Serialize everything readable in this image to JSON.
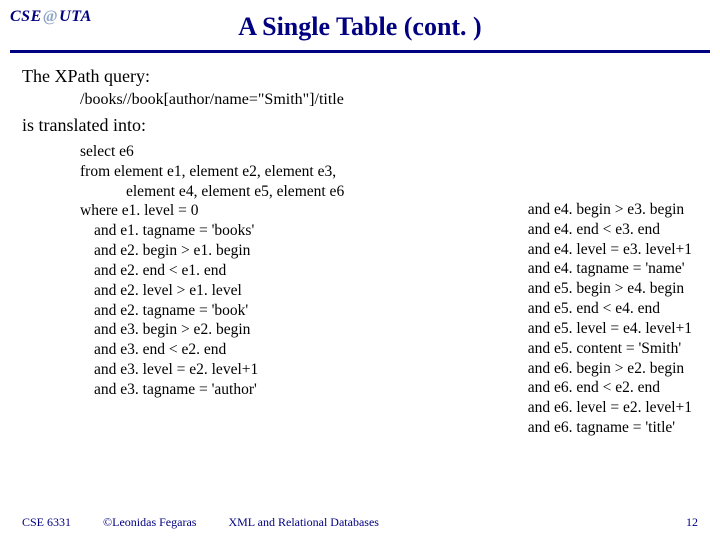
{
  "logo": {
    "prefix": "CSE",
    "at": "@",
    "suffix": "UTA"
  },
  "title": "A Single Table (cont. )",
  "body": {
    "intro1": "The XPath query:",
    "xpath": "/books//book[author/name=\"Smith\"]/title",
    "intro2": "is translated into:",
    "sql_left": [
      "select e6",
      "from element e1, element e2, element e3,",
      "        element e4, element e5, element e6",
      "where e1. level = 0",
      "  and e1. tagname = 'books'",
      "  and e2. begin > e1. begin",
      "  and e2. end < e1. end",
      "  and e2. level > e1. level",
      "  and e2. tagname = 'book'",
      "  and e3. begin > e2. begin",
      "  and e3. end < e2. end",
      "  and e3. level = e2. level+1",
      "  and e3. tagname = 'author'"
    ],
    "sql_right": [
      " and e4. begin > e3. begin",
      "and e4. end < e3. end",
      "and e4. level = e3. level+1",
      "and e4. tagname = 'name'",
      "and e5. begin > e4. begin",
      "and e5. end < e4. end",
      "and e5. level = e4. level+1",
      "and e5. content = 'Smith'",
      "and e6. begin > e2. begin",
      "and e6. end < e2. end",
      "and e6. level = e2. level+1",
      "and e6. tagname = 'title'"
    ]
  },
  "footer": {
    "course": "CSE 6331",
    "copyright": "©Leonidas Fegaras",
    "topic": "XML and Relational Databases",
    "page": "12"
  }
}
